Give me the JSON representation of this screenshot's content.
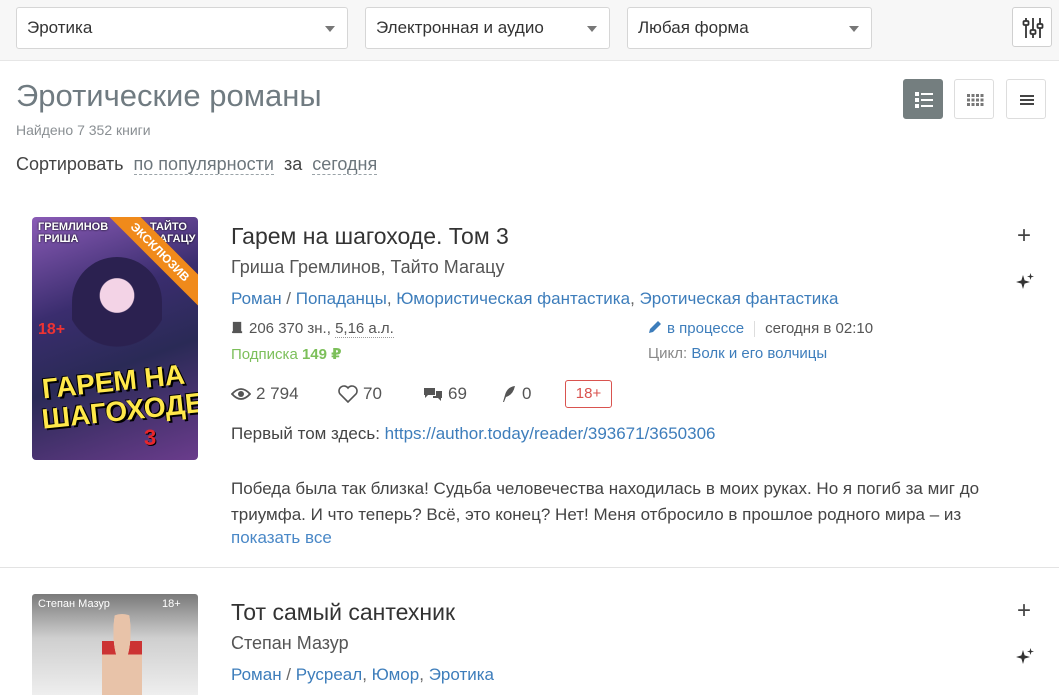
{
  "filters": {
    "genre": "Эротика",
    "format": "Электронная и аудио",
    "form": "Любая форма"
  },
  "header": {
    "title": "Эротические романы",
    "found": "Найдено 7 352 книги",
    "sort_label": "Сортировать",
    "sort_value": "по популярности",
    "period_label": "за",
    "period_value": "сегодня"
  },
  "books": [
    {
      "title": "Гарем на шагоходе. Том 3",
      "authors": "Гриша Гремлинов, Тайто Магацу",
      "genres": [
        "Роман",
        "Попаданцы",
        "Юмористическая фантастика",
        "Эротическая фантастика"
      ],
      "size": "206 370 зн., ",
      "size_al": "5,16 а.л.",
      "subscription_label": "Подписка",
      "price": "149 ₽",
      "status": "в процессе",
      "updated": "сегодня в 02:10",
      "cycle_label": "Цикл:",
      "cycle": "Волк и его волчицы",
      "views": "2 794",
      "likes": "70",
      "comments": "69",
      "rewards": "0",
      "age": "18+",
      "first_volume_label": "Первый том здесь:",
      "first_volume_link": "https://author.today/reader/393671/3650306",
      "annotation": "Победа была так близка! Судьба человечества находилась в моих руках. Но я погиб за миг до триумфа. И что теперь? Всё, это конец? Нет! Меня отбросило в прошлое родного мира – из",
      "show_all": "показать все",
      "cover": {
        "author_top_left": "ГРЕМЛИНОВ ГРИША",
        "author_top_right": "ТАЙТО МАГАЦУ",
        "age": "18+",
        "title": "ГАРЕМ НА ШАГОХОДЕ",
        "number": "3",
        "ribbon": "ЭКСКЛЮЗИВ"
      }
    },
    {
      "title": "Тот самый сантехник",
      "authors": "Степан Мазур",
      "genres": [
        "Роман",
        "Русреал",
        "Юмор",
        "Эротика"
      ],
      "cover": {
        "author": "Степан Мазур",
        "age": "18+"
      }
    }
  ],
  "colors": {
    "link": "#3d7dbb",
    "subscription": "#7cbf5a",
    "age_badge": "#d9534f",
    "ribbon": "#f08a1b",
    "active_view": "#747e7f"
  }
}
